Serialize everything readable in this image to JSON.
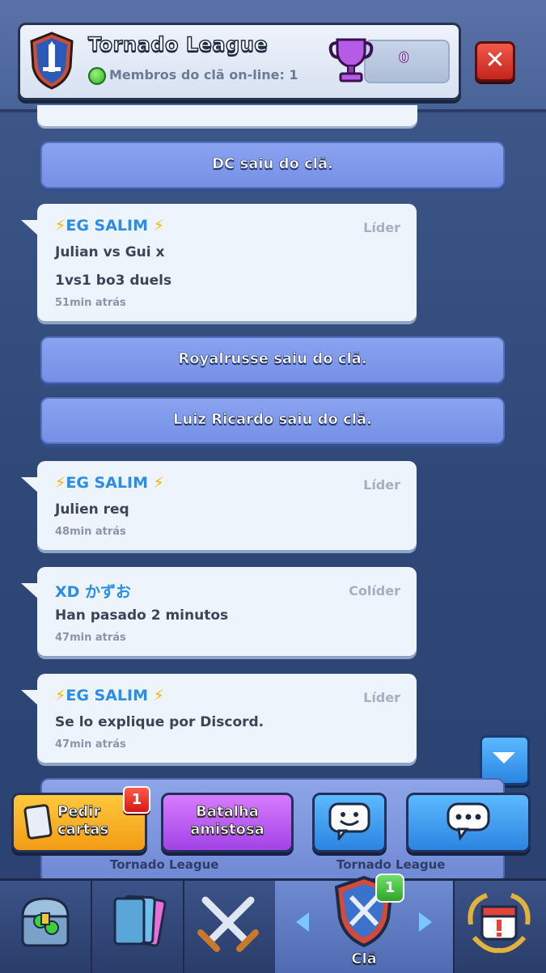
{
  "header": {
    "clan_name": "Tornado League",
    "online_text": "Membros do clã on-line: 1",
    "trophies": "0",
    "close_label": "✕"
  },
  "chat": {
    "system_messages": [
      "DC saiu do clã.",
      "Royalrusse saiu do clã.",
      "Luiz Ricardo saiu do clã."
    ],
    "messages": [
      {
        "sender": "EG SALIM",
        "role": "Líder",
        "lines": [
          "Julian vs Gui x",
          "1vs1 bo3 duels"
        ],
        "time": "51min atrás"
      },
      {
        "sender": "EG SALIM",
        "role": "Líder",
        "lines": [
          "Julien req"
        ],
        "time": "48min atrás"
      },
      {
        "sender": "XD かずお",
        "role": "Colíder",
        "lines": [
          "Han pasado 2 minutos"
        ],
        "time": "47min atrás"
      },
      {
        "sender": "EG SALIM",
        "role": "Líder",
        "lines": [
          "Se lo explique por Discord."
        ],
        "time": "47min atrás"
      }
    ]
  },
  "battle_strip": {
    "left_clan": "Tornado League",
    "right_clan": "Tornado League"
  },
  "actions": {
    "request_label_1": "Pedir",
    "request_label_2": "cartas",
    "request_badge": "1",
    "friendly_label_1": "Batalha",
    "friendly_label_2": "amistosa"
  },
  "nav": {
    "tabs": [
      "shop",
      "cards",
      "battle",
      "clan",
      "events"
    ],
    "active_label": "Clã",
    "clan_badge": "1"
  },
  "colors": {
    "accent_blue": "#2a8ee8",
    "system_purple": "#7f98ec",
    "bolt": "#f5b800"
  }
}
